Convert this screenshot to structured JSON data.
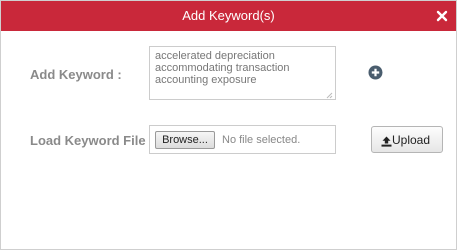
{
  "dialog": {
    "title": "Add Keyword(s)",
    "close_icon": "close-icon",
    "accent_color": "#c9283a"
  },
  "keyword": {
    "label": "Add Keyword :",
    "lines": [
      "accelerated depreciation",
      "accommodating transaction",
      "accounting exposure"
    ],
    "add_icon": "plus-circle-icon",
    "add_icon_color": "#4a5d6e"
  },
  "file": {
    "label": "Load Keyword File :",
    "browse_label": "Browse...",
    "status_text": "No file selected."
  },
  "upload": {
    "label": "Upload",
    "icon": "upload-icon"
  }
}
